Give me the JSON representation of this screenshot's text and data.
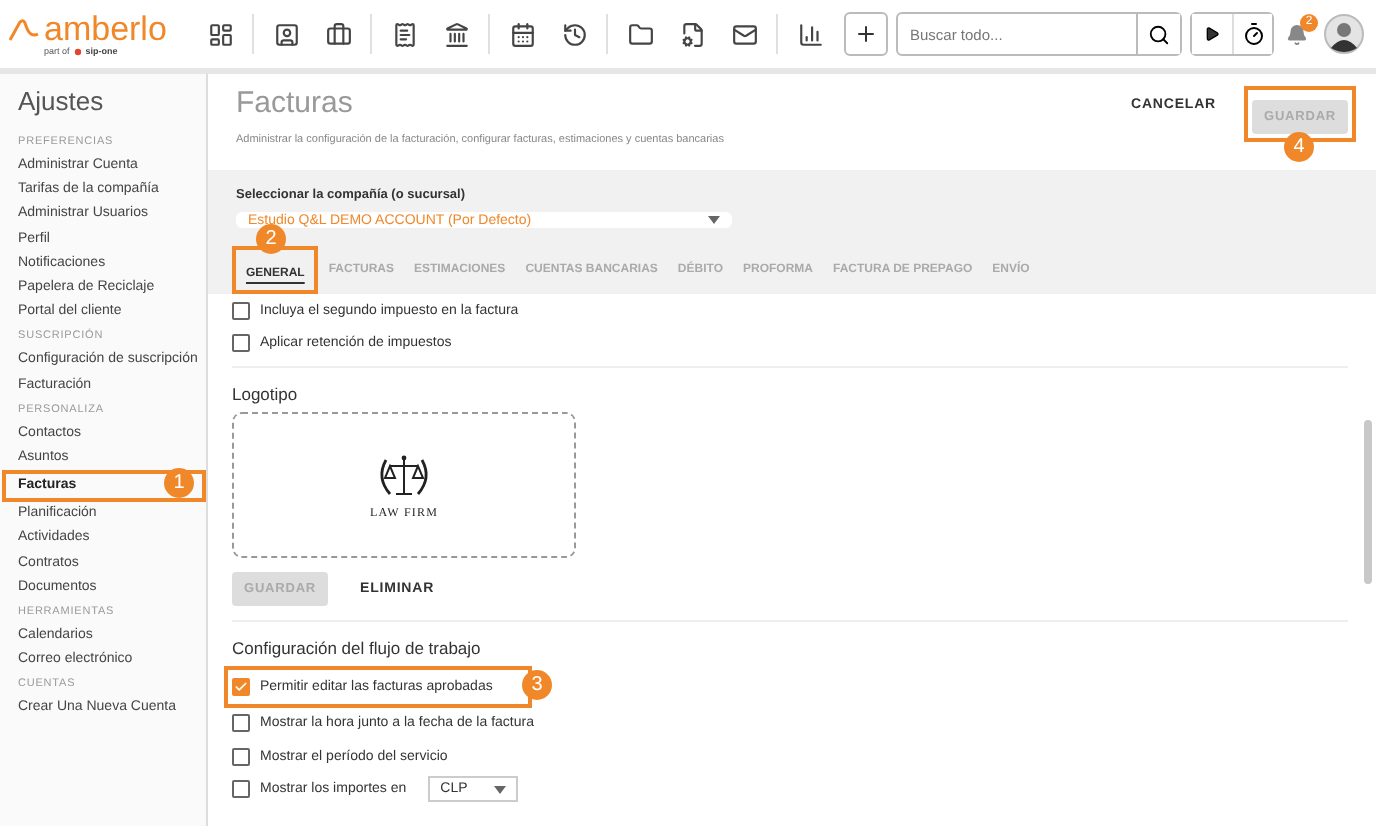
{
  "topbar": {
    "logo": "amberlo",
    "tagline": "part of",
    "tagline_brand": "sip-one",
    "search": {
      "placeholder": "Buscar todo..."
    },
    "notifications_badge": "2"
  },
  "sidebar": {
    "title": "Ajustes",
    "sections": [
      {
        "heading": "PREFERENCIAS",
        "items": [
          {
            "label": "Administrar Cuenta",
            "selected": false
          },
          {
            "label": "Tarifas de la compañía",
            "selected": false
          },
          {
            "label": "Administrar Usuarios",
            "selected": false
          },
          {
            "label": "Perfil",
            "selected": false
          },
          {
            "label": "Notificaciones",
            "selected": false
          },
          {
            "label": "Papelera de Reciclaje",
            "selected": false
          },
          {
            "label": "Portal del cliente",
            "selected": false
          }
        ]
      },
      {
        "heading": "SUSCRIPCIÓN",
        "items": [
          {
            "label": "Configuración de suscripción",
            "selected": false
          },
          {
            "label": "Facturación",
            "selected": false
          }
        ]
      },
      {
        "heading": "PERSONALIZA",
        "items": [
          {
            "label": "Contactos",
            "selected": false
          },
          {
            "label": "Asuntos",
            "selected": false
          },
          {
            "label": "Facturas",
            "selected": true,
            "callout": "1"
          },
          {
            "label": "Planificación",
            "selected": false
          },
          {
            "label": "Actividades",
            "selected": false
          },
          {
            "label": "Contratos",
            "selected": false
          },
          {
            "label": "Documentos",
            "selected": false
          }
        ]
      },
      {
        "heading": "HERRAMIENTAS",
        "items": [
          {
            "label": "Calendarios",
            "selected": false
          },
          {
            "label": "Correo electrónico",
            "selected": false
          }
        ]
      },
      {
        "heading": "CUENTAS",
        "items": [
          {
            "label": "Crear Una Nueva Cuenta",
            "selected": false
          }
        ]
      }
    ]
  },
  "page": {
    "title": "Facturas",
    "subtitle": "Administrar la configuración de la facturación, configurar facturas, estimaciones y cuentas bancarias",
    "cancel_button": "CANCELAR",
    "save_button": {
      "label": "GUARDAR",
      "disabled": true,
      "callout": "4"
    }
  },
  "company": {
    "label": "Seleccionar la compañía (o sucursal)",
    "value": "Estudio Q&L DEMO ACCOUNT (Por Defecto)"
  },
  "tabs": [
    {
      "label": "GENERAL",
      "selected": true,
      "callout": "2"
    },
    {
      "label": "FACTURAS",
      "selected": false
    },
    {
      "label": "ESTIMACIONES",
      "selected": false
    },
    {
      "label": "CUENTAS BANCARIAS",
      "selected": false
    },
    {
      "label": "DÉBITO",
      "selected": false
    },
    {
      "label": "PROFORMA",
      "selected": false
    },
    {
      "label": "FACTURA DE PREPAGO",
      "selected": false
    },
    {
      "label": "ENVÍO",
      "selected": false
    }
  ],
  "tax_options": [
    {
      "label": "Incluya el segundo impuesto en la factura",
      "checked": false
    },
    {
      "label": "Aplicar retención de impuestos",
      "checked": false
    }
  ],
  "logo_section": {
    "heading": "Logotipo",
    "logo_text": "LAW FIRM",
    "save_button": {
      "label": "GUARDAR",
      "disabled": true
    },
    "delete_button": "ELIMINAR"
  },
  "workflow": {
    "heading": "Configuración del flujo de trabajo",
    "options": [
      {
        "kind": "checkbox",
        "label": "Permitir editar las facturas aprobadas",
        "checked": true,
        "callout": "3"
      },
      {
        "kind": "checkbox",
        "label": "Mostrar la hora junto a la fecha de la factura",
        "checked": false
      },
      {
        "kind": "checkbox",
        "label": "Mostrar el período del servicio",
        "checked": false
      },
      {
        "kind": "checkbox_select",
        "label": "Mostrar los importes en",
        "checked": false,
        "select_value": "CLP"
      }
    ]
  }
}
